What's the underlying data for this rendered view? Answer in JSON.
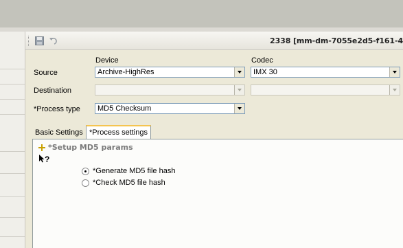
{
  "window": {
    "title": "2338 [mm-dm-7055e2d5-f161-4"
  },
  "toolbar": {
    "save_icon": "save-icon",
    "undo_icon": "undo-icon"
  },
  "form": {
    "col_device": "Device",
    "col_codec": "Codec",
    "rows": [
      {
        "label": "Source",
        "device": "Archive-HighRes",
        "codec": "IMX 30"
      },
      {
        "label": "Destination",
        "device": "",
        "codec": ""
      }
    ],
    "process_type_label": "*Process type",
    "process_type_value": "MD5 Checksum"
  },
  "tabs": [
    {
      "label": "Basic Settings"
    },
    {
      "label": "*Process settings"
    }
  ],
  "process_settings": {
    "section_title": "*Setup MD5 params",
    "help_cursor": "?",
    "options": [
      {
        "label": "*Generate MD5 file hash",
        "selected": true
      },
      {
        "label": "*Check MD5 file hash",
        "selected": false
      }
    ]
  }
}
